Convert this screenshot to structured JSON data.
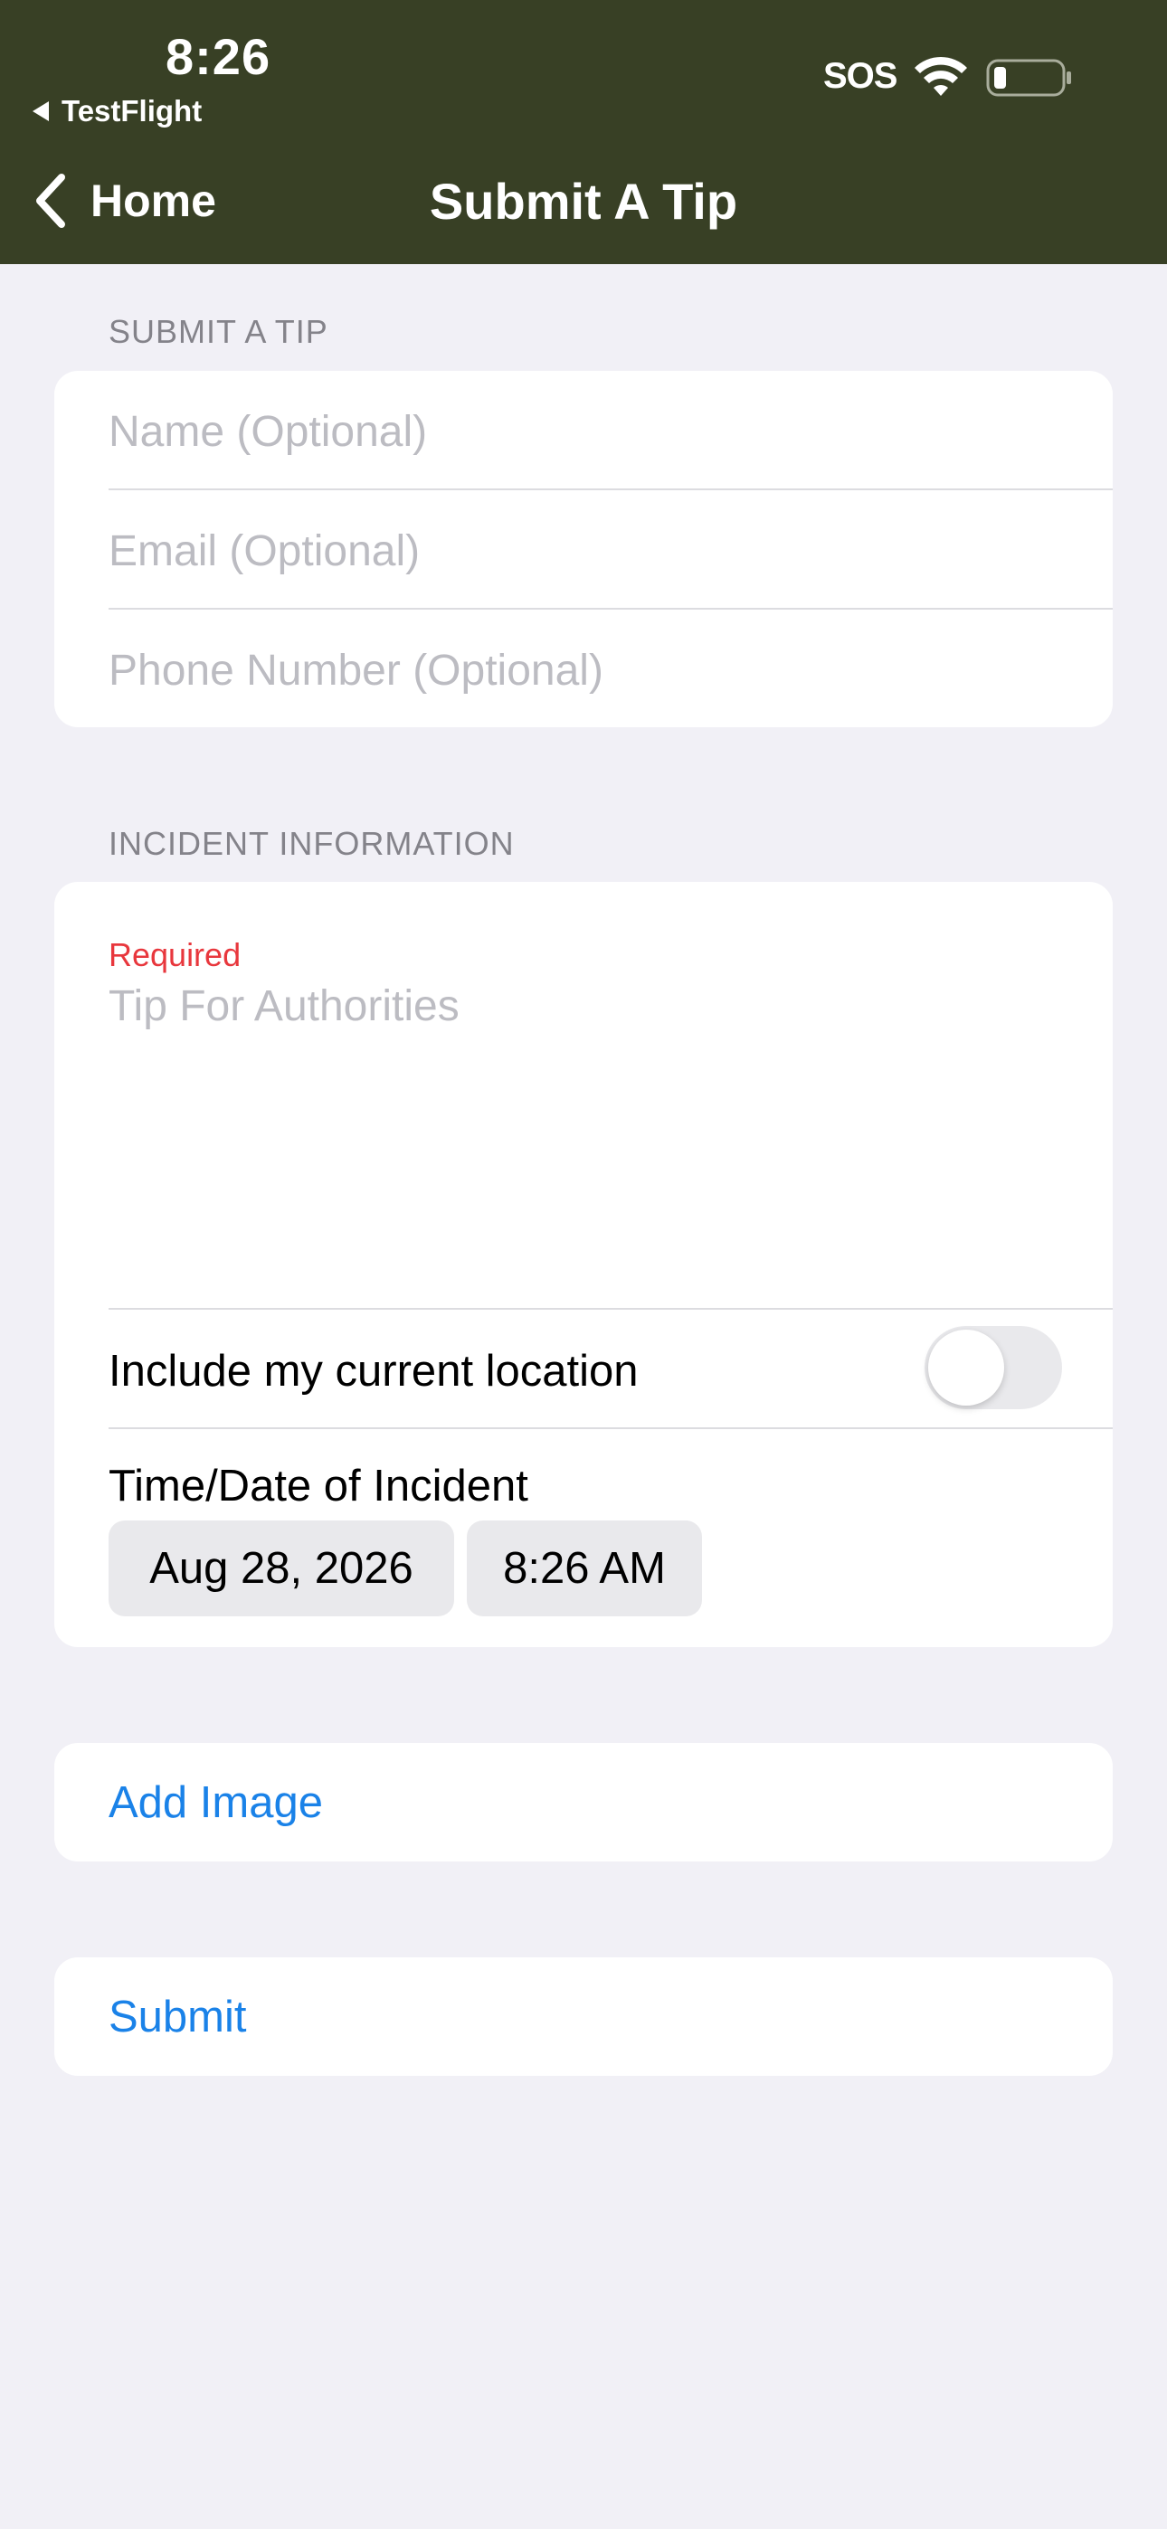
{
  "status_bar": {
    "time": "8:26",
    "back_app": "TestFlight",
    "sos": "SOS"
  },
  "nav": {
    "back_label": "Home",
    "title": "Submit A Tip"
  },
  "contact_section": {
    "header": "SUBMIT A TIP",
    "name_placeholder": "Name (Optional)",
    "email_placeholder": "Email (Optional)",
    "phone_placeholder": "Phone Number (Optional)"
  },
  "incident_section": {
    "header": "INCIDENT INFORMATION",
    "required_label": "Required",
    "tip_placeholder": "Tip For Authorities",
    "location_label": "Include my current location",
    "location_enabled": false,
    "datetime_label": "Time/Date of Incident",
    "date_value": "Aug 28, 2026",
    "time_value": "8:26 AM"
  },
  "actions": {
    "add_image": "Add Image",
    "submit": "Submit"
  },
  "colors": {
    "header_bg": "#384025",
    "page_bg": "#f1f0f6",
    "link": "#1a82e8",
    "required": "#e8373d"
  }
}
